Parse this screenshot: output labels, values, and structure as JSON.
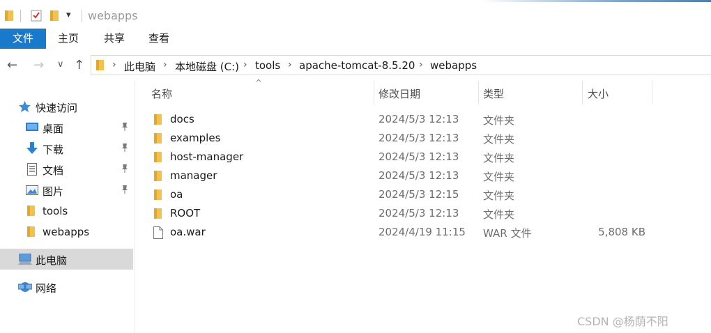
{
  "window": {
    "title": "webapps",
    "quick_access_dropdown": "▾"
  },
  "ribbon": {
    "tabs": [
      {
        "label": "文件",
        "active": true
      },
      {
        "label": "主页",
        "active": false
      },
      {
        "label": "共享",
        "active": false
      },
      {
        "label": "查看",
        "active": false
      }
    ]
  },
  "nav": {
    "back": "←",
    "forward": "→",
    "recent": "∨",
    "up": "↑"
  },
  "address": {
    "crumbs": [
      "此电脑",
      "本地磁盘 (C:)",
      "tools",
      "apache-tomcat-8.5.20",
      "webapps"
    ],
    "separator": "›"
  },
  "sidebar": {
    "items": [
      {
        "label": "快速访问",
        "icon": "star-icon",
        "pinned": false
      },
      {
        "label": "桌面",
        "icon": "desktop-icon",
        "pinned": true
      },
      {
        "label": "下载",
        "icon": "download-icon",
        "pinned": true
      },
      {
        "label": "文档",
        "icon": "document-icon",
        "pinned": true
      },
      {
        "label": "图片",
        "icon": "picture-icon",
        "pinned": true
      },
      {
        "label": "tools",
        "icon": "folder-icon",
        "pinned": false
      },
      {
        "label": "webapps",
        "icon": "folder-icon",
        "pinned": false
      },
      {
        "label": "此电脑",
        "icon": "computer-icon",
        "pinned": false,
        "selected": true
      },
      {
        "label": "网络",
        "icon": "network-icon",
        "pinned": false
      }
    ],
    "pin_glyph": "📌"
  },
  "columns": {
    "name": "名称",
    "date": "修改日期",
    "type": "类型",
    "size": "大小",
    "sort_glyph": "^"
  },
  "files": [
    {
      "name": "docs",
      "date": "2024/5/3 12:13",
      "type": "文件夹",
      "size": "",
      "icon": "folder-icon"
    },
    {
      "name": "examples",
      "date": "2024/5/3 12:13",
      "type": "文件夹",
      "size": "",
      "icon": "folder-icon"
    },
    {
      "name": "host-manager",
      "date": "2024/5/3 12:13",
      "type": "文件夹",
      "size": "",
      "icon": "folder-icon"
    },
    {
      "name": "manager",
      "date": "2024/5/3 12:13",
      "type": "文件夹",
      "size": "",
      "icon": "folder-icon"
    },
    {
      "name": "oa",
      "date": "2024/5/3 12:15",
      "type": "文件夹",
      "size": "",
      "icon": "folder-icon"
    },
    {
      "name": "ROOT",
      "date": "2024/5/3 12:13",
      "type": "文件夹",
      "size": "",
      "icon": "folder-icon"
    },
    {
      "name": "oa.war",
      "date": "2024/4/19 11:15",
      "type": "WAR 文件",
      "size": "5,808 KB",
      "icon": "file-icon"
    }
  ],
  "watermark": "CSDN @杨荫不阳"
}
